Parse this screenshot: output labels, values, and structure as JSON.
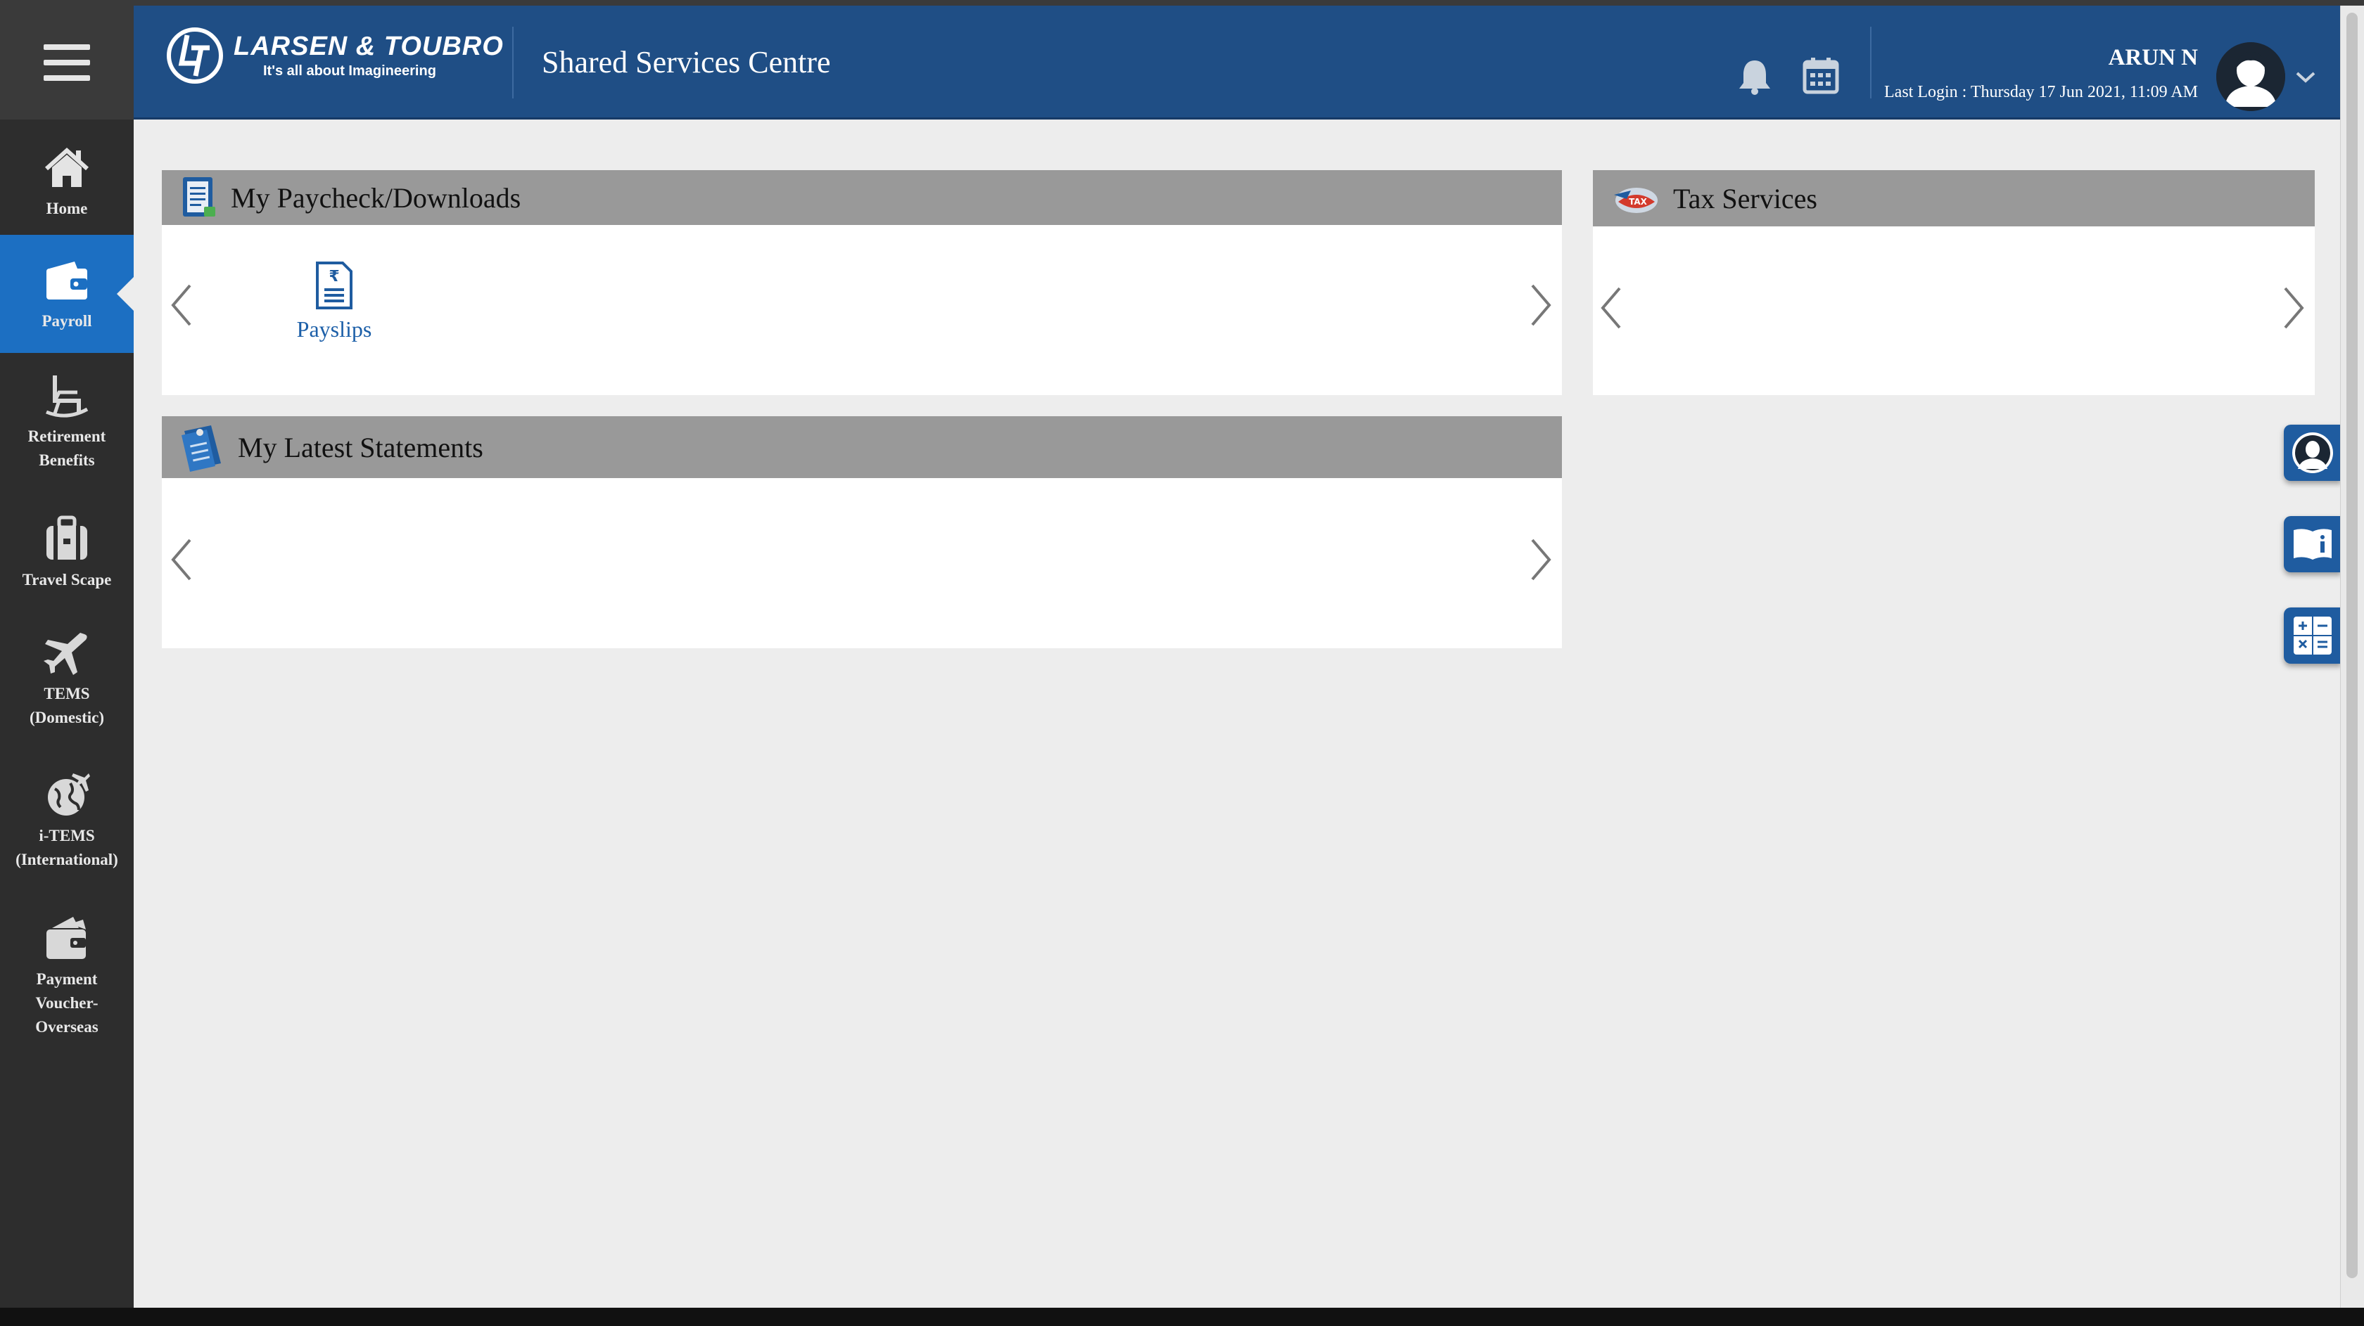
{
  "colors": {
    "header_bg": "#1f4e85",
    "sidebar_bg": "#2d2d2d",
    "sidebar_active": "#1c6fc2",
    "panel_header": "#999999",
    "page_bg": "#ededed",
    "link": "#1c5fa8"
  },
  "header": {
    "logo_name": "LARSEN & TOUBRO",
    "logo_tagline": "It's all about Imagineering",
    "app_title": "Shared Services Centre",
    "icons": [
      "bell-icon",
      "calendar-icon"
    ],
    "user": {
      "name": "ARUN N",
      "last_login": "Last Login : Thursday 17 Jun 2021, 11:09 AM"
    }
  },
  "sidebar": {
    "items": [
      {
        "label_lines": [
          "Home"
        ],
        "icon": "home-icon",
        "active": false
      },
      {
        "label_lines": [
          "Payroll"
        ],
        "icon": "wallet-icon",
        "active": true
      },
      {
        "label_lines": [
          "Retirement",
          "Benefits"
        ],
        "icon": "rocking-chair-icon",
        "active": false
      },
      {
        "label_lines": [
          "Travel Scape"
        ],
        "icon": "suitcase-icon",
        "active": false
      },
      {
        "label_lines": [
          "TEMS",
          "(Domestic)"
        ],
        "icon": "airplane-icon",
        "active": false
      },
      {
        "label_lines": [
          "i-TEMS",
          "(International)"
        ],
        "icon": "globe-plane-icon",
        "active": false
      },
      {
        "label_lines": [
          "Payment",
          "Voucher-",
          "Overseas"
        ],
        "icon": "payment-voucher-icon",
        "active": false
      }
    ]
  },
  "panels": {
    "paycheck": {
      "title": "My Paycheck/Downloads",
      "tiles": [
        {
          "label": "Payslips",
          "icon": "rupee-document-icon"
        }
      ]
    },
    "tax": {
      "title": "Tax Services",
      "tiles": []
    },
    "statements": {
      "title": "My Latest Statements",
      "tiles": []
    }
  },
  "floating_buttons": [
    "support-agent-icon",
    "info-book-icon",
    "calculator-icon"
  ]
}
